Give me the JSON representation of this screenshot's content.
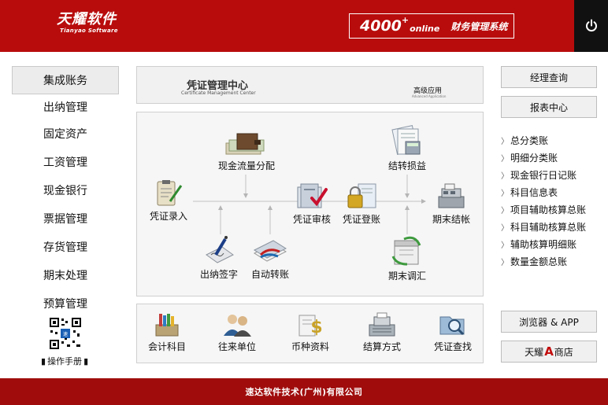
{
  "header": {
    "brand_cn": "天耀软件",
    "brand_en": "Tianyao Software",
    "product_number": "4000",
    "product_plus": "+",
    "product_online": "online",
    "product_name": "财务管理系统",
    "power_icon": "power-icon",
    "bg_color": "#b80c0c"
  },
  "left_nav": {
    "active": "集成账务",
    "items": [
      "出纳管理",
      "固定资产",
      "工资管理",
      "现金银行",
      "票据管理",
      "存货管理",
      "期末处理",
      "预算管理"
    ],
    "manual_label": "操作手册"
  },
  "center": {
    "title_cn": "凭证管理中心",
    "title_en": "Certificate Management Center",
    "advanced_cn": "高级应用",
    "advanced_en": "Advanced Application",
    "flow": {
      "voucher_entry": "凭证录入",
      "cash_flow": "现金流量分配",
      "cashier_sign": "出纳签字",
      "auto_transfer": "自动转账",
      "voucher_review": "凭证审核",
      "voucher_post": "凭证登账",
      "carry_pl": "结转损益",
      "period_adjust": "期末调汇",
      "period_close": "期末结帐"
    },
    "tools": [
      "会计科目",
      "往来单位",
      "币种资料",
      "结算方式",
      "凭证查找"
    ]
  },
  "right": {
    "manager_query": "经理查询",
    "report_center": "报表中心",
    "reports": [
      "总分类账",
      "明细分类账",
      "现金银行日记账",
      "科目信息表",
      "项目辅助核算总账",
      "科目辅助核算总账",
      "辅助核算明细账",
      "数量金额总账"
    ],
    "browser_app": "浏览器 & APP",
    "store_prefix": "天耀",
    "store_a": "A",
    "store_suffix": "商店"
  },
  "footer": {
    "company": "速达软件技术(广州)有限公司"
  }
}
